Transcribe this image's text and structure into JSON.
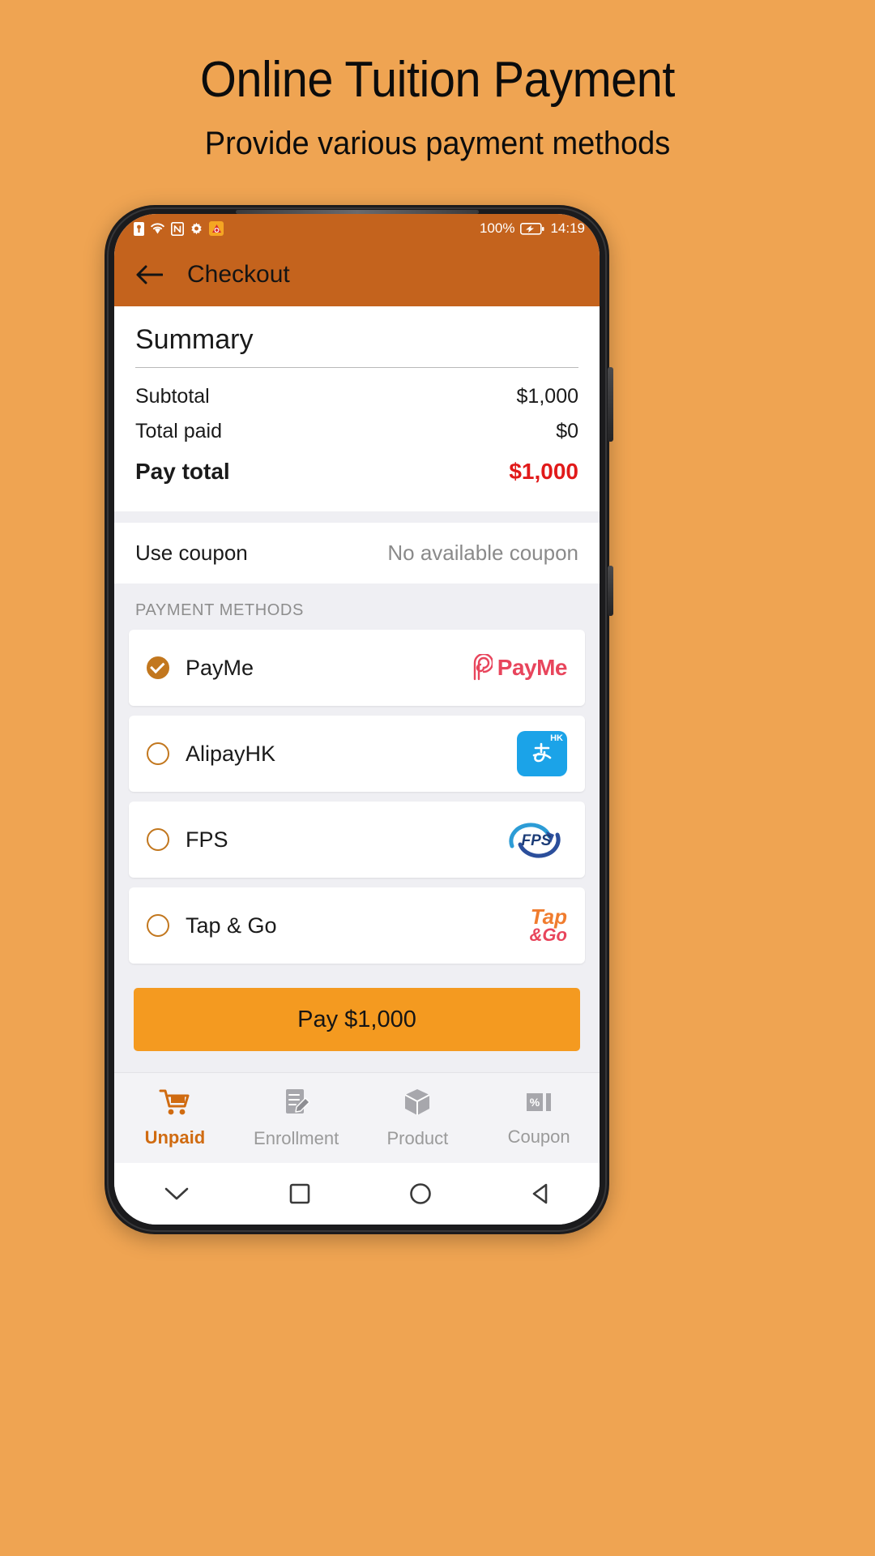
{
  "promo": {
    "title": "Online Tuition Payment",
    "subtitle": "Provide various payment methods"
  },
  "colors": {
    "background": "#EFA452",
    "appbar": "#C4631D",
    "accent": "#C2771E",
    "pay_button": "#F49A20",
    "total_red": "#E11A1A",
    "tab_active": "#D06B11"
  },
  "statusbar": {
    "icons": [
      "key-icon",
      "wifi-icon",
      "nfc-icon",
      "gear-icon",
      "app-icon"
    ],
    "battery_percent": "100%",
    "time": "14:19"
  },
  "appbar": {
    "back_icon": "back-arrow-icon",
    "title": "Checkout"
  },
  "summary": {
    "heading": "Summary",
    "rows": [
      {
        "label": "Subtotal",
        "value": "$1,000"
      },
      {
        "label": "Total paid",
        "value": "$0"
      }
    ],
    "total": {
      "label": "Pay total",
      "value": "$1,000"
    }
  },
  "coupon": {
    "label": "Use coupon",
    "value": "No available coupon"
  },
  "payment": {
    "section_label": "PAYMENT METHODS",
    "methods": [
      {
        "name": "PayMe",
        "selected": true,
        "logo": "payme-logo",
        "logo_text": "PayMe"
      },
      {
        "name": "AlipayHK",
        "selected": false,
        "logo": "alipayhk-logo",
        "logo_text": "HK"
      },
      {
        "name": "FPS",
        "selected": false,
        "logo": "fps-logo",
        "logo_text": "FPS"
      },
      {
        "name": "Tap & Go",
        "selected": false,
        "logo": "tapgo-logo",
        "logo_text": "Tap",
        "logo_text2": "&Go"
      }
    ]
  },
  "pay_button": {
    "label": "Pay $1,000"
  },
  "tabs": [
    {
      "label": "Unpaid",
      "icon": "cart-icon",
      "active": true
    },
    {
      "label": "Enrollment",
      "icon": "note-edit-icon",
      "active": false
    },
    {
      "label": "Product",
      "icon": "box-icon",
      "active": false
    },
    {
      "label": "Coupon",
      "icon": "percent-ticket-icon",
      "active": false
    }
  ],
  "navbar": [
    "chevron-down-icon",
    "square-icon",
    "circle-icon",
    "triangle-back-icon"
  ]
}
